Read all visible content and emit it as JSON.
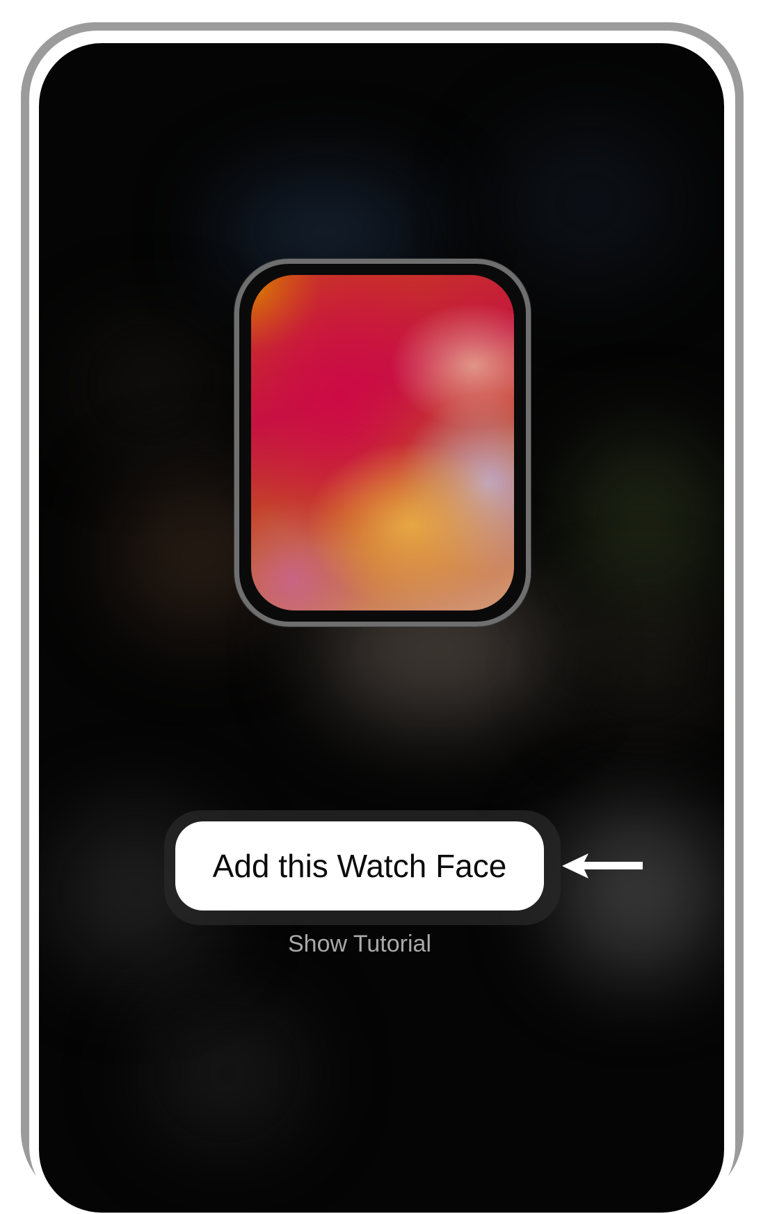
{
  "watch_face": {
    "preview_name": "gradient-watch-face-preview"
  },
  "actions": {
    "add_label": "Add this Watch Face",
    "tutorial_label": "Show Tutorial"
  },
  "annotation": {
    "arrow_icon": "left-arrow-icon"
  },
  "colors": {
    "screen_background": "#050505",
    "button_background": "#ffffff",
    "button_text": "#0b0b0b",
    "secondary_text": "#a9a9a9",
    "frame": "#9b9b9b"
  }
}
